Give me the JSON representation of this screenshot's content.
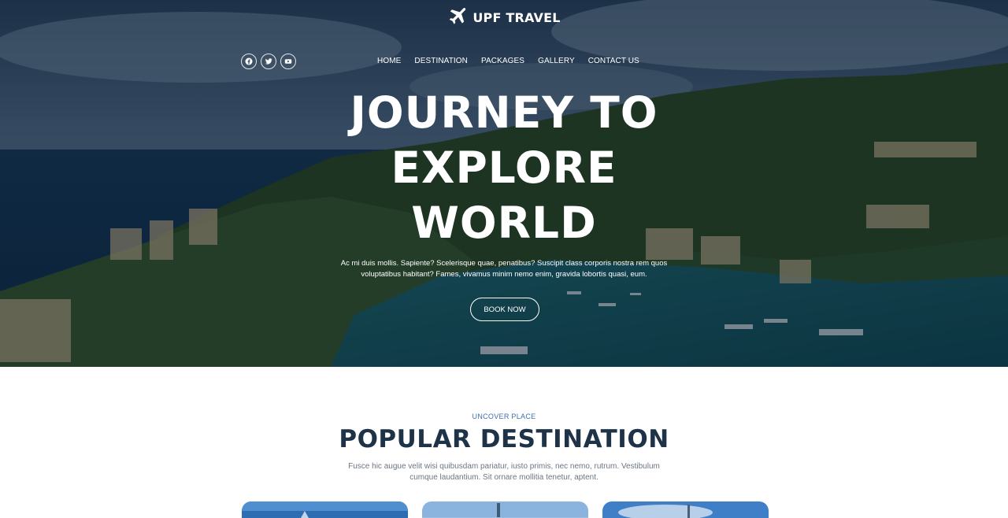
{
  "brand": {
    "name": "UPF TRAVEL",
    "icon": "airplane-icon"
  },
  "social": [
    {
      "name": "facebook-icon"
    },
    {
      "name": "twitter-icon"
    },
    {
      "name": "youtube-icon"
    }
  ],
  "nav": {
    "items": [
      {
        "label": "HOME"
      },
      {
        "label": "DESTINATION"
      },
      {
        "label": "PACKAGES"
      },
      {
        "label": "GALLERY"
      },
      {
        "label": "CONTACT US"
      }
    ]
  },
  "hero": {
    "headline": [
      "JOURNEY TO",
      "EXPLORE",
      "WORLD"
    ],
    "description": "Ac mi duis mollis. Sapiente? Scelerisque quae, penatibus? Suscipit class corporis nostra rem quos voluptatibus habitant? Fames, vivamus minim nemo enim, gravida lobortis quasi, eum.",
    "cta_label": "BOOK NOW"
  },
  "destinations": {
    "kicker": "UNCOVER PLACE",
    "title": "POPULAR DESTINATION",
    "description": "Fusce hic augue velit wisi quibusdam pariatur, iusto primis, nec nemo, rutrum. Vestibulum cumque laudantium. Sit ornare mollitia tenetur, aptent."
  },
  "colors": {
    "accent": "#3e6fa8",
    "heading": "#1f3348",
    "body_text": "#6b7682"
  }
}
